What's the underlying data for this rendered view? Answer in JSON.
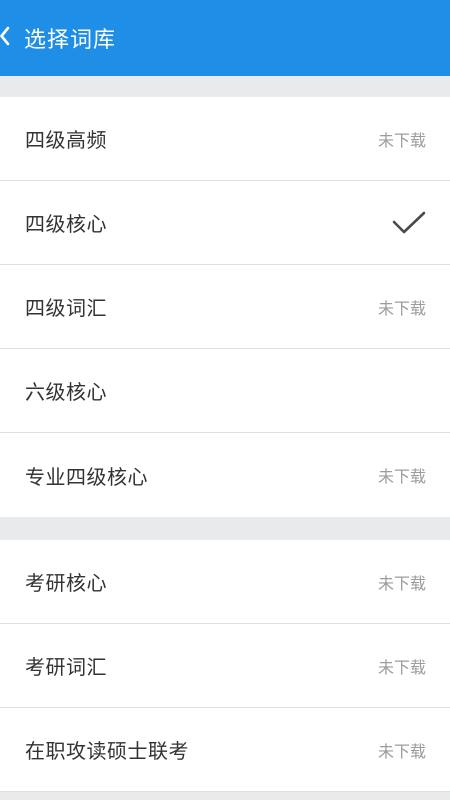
{
  "header": {
    "title": "选择词库",
    "back_icon": "chevron-left-icon",
    "background": "#1f8ee6"
  },
  "groups": [
    {
      "items": [
        {
          "label": "四级高频",
          "status": "未下载"
        },
        {
          "label": "四级核心",
          "status": "",
          "selected": true,
          "icon": "checkmark-icon"
        },
        {
          "label": "四级词汇",
          "status": "未下载"
        },
        {
          "label": "六级核心",
          "status": ""
        },
        {
          "label": "专业四级核心",
          "status": "未下载"
        }
      ]
    },
    {
      "items": [
        {
          "label": "考研核心",
          "status": "未下载"
        },
        {
          "label": "考研词汇",
          "status": "未下载"
        },
        {
          "label": "在职攻读硕士联考",
          "status": "未下载"
        }
      ]
    }
  ]
}
